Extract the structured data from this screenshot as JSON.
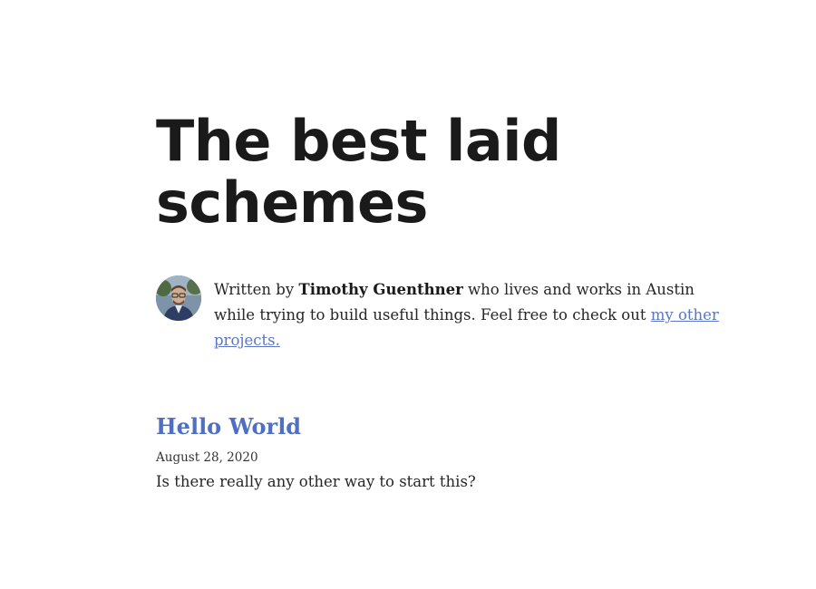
{
  "site": {
    "title": "The best laid schemes"
  },
  "bio": {
    "prefix": "Written by ",
    "author": "Timothy Guenthner",
    "middle": " who lives and works in Austin while trying to build useful things. Feel free to check out ",
    "link_label": "my other projects."
  },
  "posts": [
    {
      "title": "Hello World",
      "date": "August 28, 2020",
      "excerpt": "Is there really any other way to start this?"
    }
  ],
  "colors": {
    "link": "#5b76c6",
    "post_title": "#4f6fc4",
    "heading": "#1a1a1a"
  }
}
